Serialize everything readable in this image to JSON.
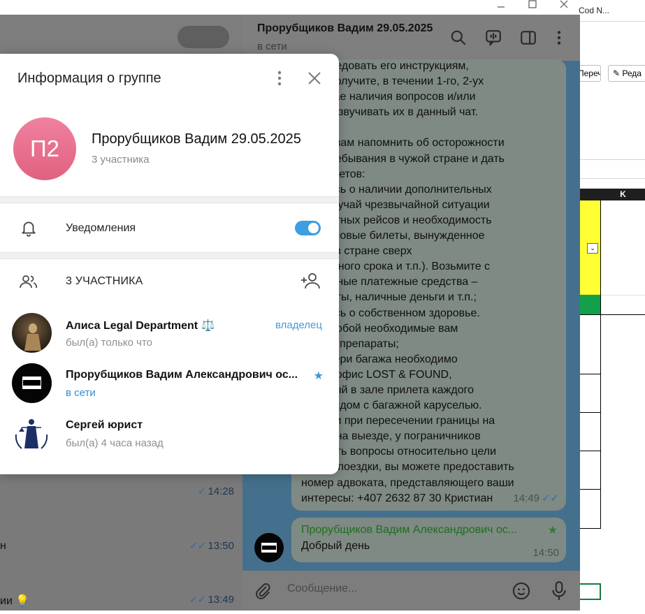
{
  "excel": {
    "tab_label": "Cod N...",
    "button_left": "Перечна",
    "button_right": "Реда",
    "column_header": "K"
  },
  "left_pane": {
    "rows": [
      {
        "text": "",
        "time": "14:28"
      },
      {
        "text": "н",
        "time": "13:50"
      },
      {
        "text": "ии",
        "time": "13:49"
      }
    ]
  },
  "chat": {
    "title": "Прорубщиков Вадим 29.05.2025",
    "status": "в сети",
    "message_text": "Вас следовать его инструкциям,\nе Вы получите, в течении 1-го, 2-ух\nв случае наличия вопросов и/или\nаний, озвучивать их в данный чат.\n\nхотим вам напомнить об осторожности\nиод пребывания в чужой стране и дать\nько советов:\nротьтесь о наличии дополнительных\nв на случай чрезвычайной ситуации\nа обратных рейсов и необходимость\nрести новые билеты, вынужденное\nвание в стране сверх\nированного срока и т.п.). Возьмите с\nразличные платежные средства –\nые карты, наличные деньги и т.п.;\nротьтесь о собственном здоровье.\nите с собой необходимые вам\nинские препараты;\nае потери багажа необходимо\nться в офис LOST & FOUND,\nоженный в зале прилета каждого\nорта рядом с багажной каруселью.\nае если при пересечении границы на\n, так и на выезде, у пограничников\nозникать вопросы относительно цели\nвашей поездки, вы можете предоставить\nномер адвоката, представляющего ваши\nинтересы: +407 2632 87 30 Кристиан",
    "message_time": "14:49",
    "check_icon": "double-check-icon",
    "reply_sender": "Прорубщиков Вадим Александрович ос...",
    "reply_text": "Добрый день",
    "reply_time": "14:50",
    "composer_placeholder": "Сообщение..."
  },
  "modal": {
    "title": "Информация о группе",
    "group_initials": "П2",
    "group_name": "Прорубщиков Вадим 29.05.2025",
    "member_count": "3 участника",
    "notifications_label": "Уведомления",
    "notifications_on": true,
    "members_header": "3 УЧАСТНИКА",
    "members": [
      {
        "name": "Алиса Legal Department ⚖️",
        "status": "был(а) только что",
        "role": "владелец",
        "online": false
      },
      {
        "name": "Прорубщиков Вадим Александрович ос...",
        "status": "в сети",
        "role": "",
        "online": true
      },
      {
        "name": "Сергей юрист",
        "status": "был(а) 4 часа назад",
        "role": "",
        "online": false
      }
    ]
  },
  "colors": {
    "accent": "#3d9ee0",
    "avatar_gradient_top": "#f0819e",
    "online": "#2e8ccf"
  }
}
